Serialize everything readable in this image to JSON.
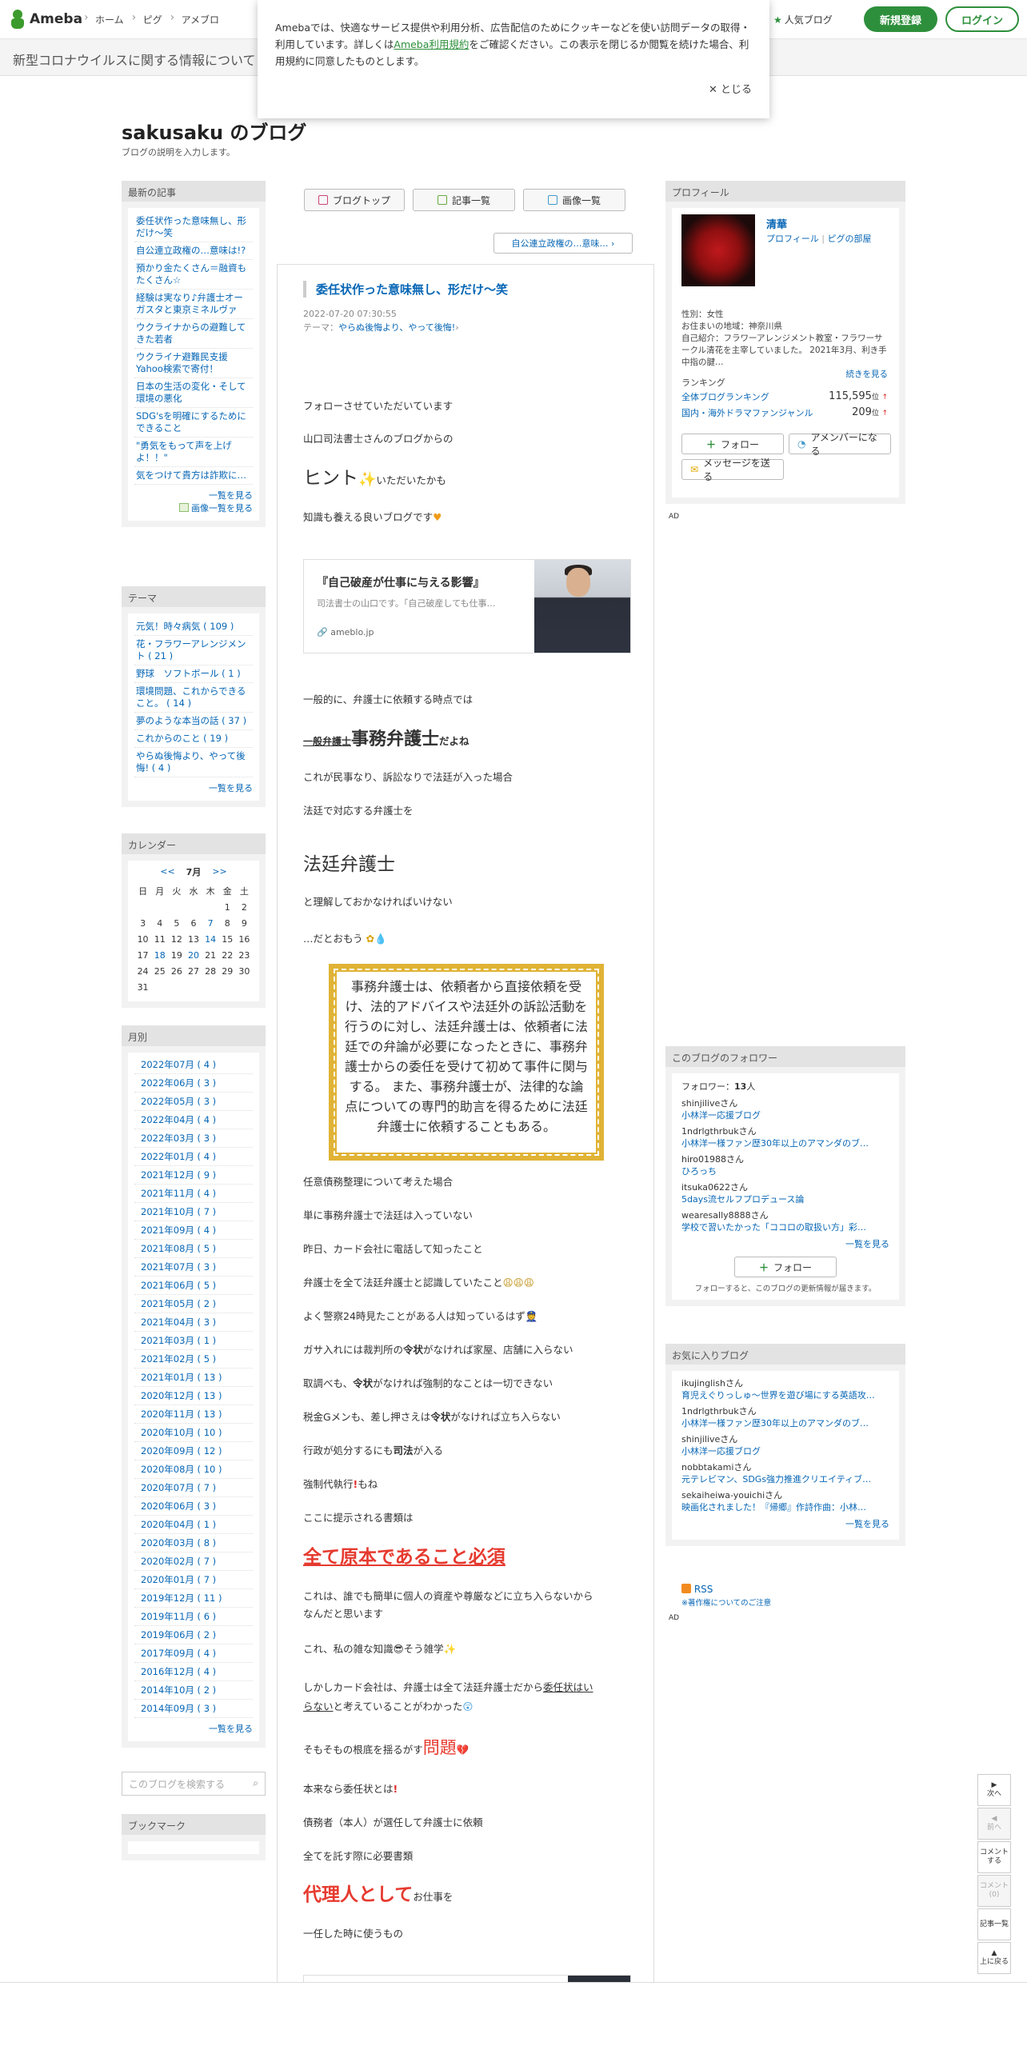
{
  "header": {
    "logo_text": "Ameba",
    "nav": [
      "ホーム",
      "ピグ",
      "アメブロ"
    ],
    "popular": "人気ブログ",
    "signup": "新規登録",
    "login": "ログイン"
  },
  "banner": {
    "text": "新型コロナウイルスに関する情報について"
  },
  "cookie": {
    "text1": "Amebaでは、快適なサービス提供や利用分析、広告配信のためにクッキーなどを使い訪問データの取得・利用しています。詳しくは",
    "link": "Ameba利用規約",
    "text2": "をご確認ください。この表示を閉じるか閲覧を続けた場合、利用規約に同意したものとします。",
    "close": "✕ とじる"
  },
  "blog": {
    "title": "sakusaku のブログ",
    "description": "ブログの説明を入力します。"
  },
  "latest": {
    "heading": "最新の記事",
    "items": [
      "委任状作った意味無し、形だけ〜笑",
      "自公連立政権の…意味は!?",
      "預かり金たくさん＝融資もたくさん☆",
      "経験は実なり♪弁護士オーガスタと東京ミネルヴァ",
      "ウクライナからの避難してきた若者",
      "ウクライナ避難民支援Yahoo検索で寄付！",
      "日本の生活の変化・そして環境の悪化",
      "SDG'sを明確にするためにできること",
      "\"勇気をもって声を上げよ！！\"",
      "気をつけて貴方は詐欺に…"
    ],
    "more": "一覧を見る",
    "images": "画像一覧を見る"
  },
  "themes": {
    "heading": "テーマ",
    "items": [
      "元気！時々病気 ( 109 )",
      "花・フラワーアレンジメント ( 21 )",
      "野球　ソフトボール ( 1 )",
      "環境問題、これからできること。 ( 14 )",
      "夢のような本当の話 ( 37 )",
      "これからのこと ( 19 )",
      "やらぬ後悔より、やって後悔! ( 4 )"
    ],
    "more": "一覧を見る"
  },
  "calendar": {
    "heading": "カレンダー",
    "prev": "<<",
    "month": "7月",
    "next": ">>",
    "weekdays": [
      "日",
      "月",
      "火",
      "水",
      "木",
      "金",
      "土"
    ],
    "weeks": [
      [
        "",
        "",
        "",
        "",
        "",
        "1",
        "2"
      ],
      [
        "3",
        "4",
        "5",
        "6",
        "7",
        "8",
        "9"
      ],
      [
        "10",
        "11",
        "12",
        "13",
        "14",
        "15",
        "16"
      ],
      [
        "17",
        "18",
        "19",
        "20",
        "21",
        "22",
        "23"
      ],
      [
        "24",
        "25",
        "26",
        "27",
        "28",
        "29",
        "30"
      ],
      [
        "31",
        "",
        "",
        "",
        "",
        "",
        ""
      ]
    ],
    "linked_days": [
      "7",
      "14",
      "18",
      "20"
    ]
  },
  "archive": {
    "heading": "月別",
    "items": [
      "2022年07月 ( 4 )",
      "2022年06月 ( 3 )",
      "2022年05月 ( 3 )",
      "2022年04月 ( 4 )",
      "2022年03月 ( 3 )",
      "2022年01月 ( 4 )",
      "2021年12月 ( 9 )",
      "2021年11月 ( 4 )",
      "2021年10月 ( 7 )",
      "2021年09月 ( 4 )",
      "2021年08月 ( 5 )",
      "2021年07月 ( 3 )",
      "2021年06月 ( 5 )",
      "2021年05月 ( 2 )",
      "2021年04月 ( 3 )",
      "2021年03月 ( 1 )",
      "2021年02月 ( 5 )",
      "2021年01月 ( 13 )",
      "2020年12月 ( 13 )",
      "2020年11月 ( 13 )",
      "2020年10月 ( 10 )",
      "2020年09月 ( 12 )",
      "2020年08月 ( 10 )",
      "2020年07月 ( 7 )",
      "2020年06月 ( 3 )",
      "2020年04月 ( 1 )",
      "2020年03月 ( 8 )",
      "2020年02月 ( 7 )",
      "2020年01月 ( 7 )",
      "2019年12月 ( 11 )",
      "2019年11月 ( 6 )",
      "2019年06月 ( 2 )",
      "2017年09月 ( 4 )",
      "2016年12月 ( 4 )",
      "2014年10月 ( 2 )",
      "2014年09月 ( 3 )"
    ],
    "more": "一覧を見る"
  },
  "search": {
    "placeholder": "このブログを検索する"
  },
  "bookmark": {
    "heading": "ブックマーク"
  },
  "tabs": [
    "ブログトップ",
    "記事一覧",
    "画像一覧"
  ],
  "prev_article": "自公連立政権の…意味…",
  "article": {
    "title": "委任状作った意味無し、形だけ〜笑",
    "date": "2022-07-20 07:30:55",
    "theme_label": "テーマ：",
    "theme": "やらぬ後悔より、やって後悔!",
    "p1": "フォローさせていただいています",
    "p2": "山口司法書士さんのブログからの",
    "hint_big": "ヒント",
    "hint_small": "いただいたかも",
    "p4": "知識も養える良いブログです",
    "card_title": "『自己破産が仕事に与える影響』",
    "card_desc": "司法書士の山口です。「自己破産しても仕事…",
    "card_url": "ameblo.jp",
    "p5": "一般的に、弁護士に依頼する時点では",
    "p6_small": "一般弁護士",
    "p6_big": "事務弁護士",
    "p6_end": "だよね",
    "p7": "これが民事なり、訴訟なりで法廷が入った場合",
    "p8": "法廷で対応する弁護士を",
    "p9": "法廷弁護士",
    "p10": "と理解しておかなければいけない",
    "p11": "…だとおもう",
    "quote": "事務弁護士は、依頼者から直接依頼を受け、法的アドバイスや法廷外の訴訟活動を行うのに対し、法廷弁護士は、依頼者に法廷での弁論が必要になったときに、事務弁護士からの委任を受けて初めて事件に関与する。 また、事務弁護士が、法律的な論点についての専門的助言を得るために法廷弁護士に依頼することもある。",
    "p12": "任意債務整理について考えた場合",
    "p13": "単に事務弁護士で法廷は入っていない",
    "p14": "昨日、カード会社に電話して知ったこと",
    "p15": "弁護士を全て法廷弁護士と認識していたこと",
    "p16": "よく警察24時見たことがある人は知っているはず",
    "p17a": "ガサ入れには裁判所の",
    "p17b": "令状",
    "p17c": "がなければ家屋、店舗に入らない",
    "p18a": "取調べも、",
    "p18b": "令状",
    "p18c": "がなければ強制的なことは一切できない",
    "p19a": "税金Gメンも、差し押さえは",
    "p19b": "令状",
    "p19c": "がなければ立ち入らない",
    "p20a": "行政が処分するにも",
    "p20b": "司法",
    "p20c": "が入る",
    "p21a": "強制代執行",
    "p21b": "もね",
    "p22": "ここに提示される書類は",
    "p23": "全て原本であること必須",
    "p24a": "これは、誰でも簡単に個人の資産や尊厳などに立ち入らないから",
    "p24b": "なんだと思います",
    "p25a": "これ、私の雑な知識",
    "p25b": "そう雑学",
    "p26a": "しかしカード会社は、弁護士は全て法廷弁護士だから",
    "p26b": "委任状はい",
    "p26c": "らない",
    "p26d": "と考えていることがわかった",
    "p27a": "そもそもの根底を揺るがす",
    "p27b": "問題",
    "p28": "本来なら委任状とは",
    "p29": "債務者（本人）が選任して弁護士に依頼",
    "p30": "全てを託す際に必要書類",
    "p31a": "代理人として",
    "p31b": "お仕事を",
    "p32": "一任した時に使うもの"
  },
  "profile": {
    "heading": "プロフィール",
    "name": "清華",
    "link1": "プロフィール",
    "link2": "ピグの部屋",
    "gender": "性別：女性",
    "area": "お住まいの地域：神奈川県",
    "intro": "自己紹介：フラワーアレンジメント教室・フラワーサークル清花を主宰していました。 2021年3月、利き手中指の腱…",
    "more": "続きを見る",
    "ranking_label": "ランキング",
    "rank1_name": "全体ブログランキング",
    "rank1_val": "115,595",
    "rank2_name": "国内・海外ドラマファンジャンル",
    "rank2_val": "209",
    "rank_unit": "位",
    "follow": "フォロー",
    "amember": "アメンバーになる",
    "message": "メッセージを送る"
  },
  "ad": "AD",
  "followers": {
    "heading": "このブログのフォロワー",
    "count_label": "フォロワー：",
    "count": "13",
    "count_unit": "人",
    "items": [
      {
        "user": "shinjiliveさん",
        "blog": "小林洋一応援ブログ"
      },
      {
        "user": "1ndrlgthrbukさん",
        "blog": "小林洋一様ファン歴30年以上のアマンダのブ…"
      },
      {
        "user": "hiro01988さん",
        "blog": "ひろっち"
      },
      {
        "user": "itsuka0622さん",
        "blog": "5days流セルフプロデュース論"
      },
      {
        "user": "wearesally8888さん",
        "blog": "学校で習いたかった「ココロの取扱い方」彩…"
      }
    ],
    "more": "一覧を見る",
    "follow": "フォロー",
    "note": "フォローすると、このブログの更新情報が届きます。"
  },
  "favorites": {
    "heading": "お気に入りブログ",
    "items": [
      {
        "user": "ikujinglishさん",
        "blog": "育児えぐりっしゅ〜世界を遊び場にする英語攻…"
      },
      {
        "user": "1ndrlgthrbukさん",
        "blog": "小林洋一様ファン歴30年以上のアマンダのブ…"
      },
      {
        "user": "shinjiliveさん",
        "blog": "小林洋一応援ブログ"
      },
      {
        "user": "nobbtakamiさん",
        "blog": "元テレビマン、SDGs強力推進クリエイティブ…"
      },
      {
        "user": "sekaiheiwa-youichiさん",
        "blog": "映画化されました！『帰郷』作詩作曲：小林…"
      }
    ],
    "more": "一覧を見る"
  },
  "rss": {
    "label": "RSS",
    "note": "※著作権についてのご注意"
  },
  "sidenav": {
    "next": "次へ",
    "prev": "前へ",
    "comment": "コメントする",
    "comment_count": "コメント(0)",
    "list": "記事一覧",
    "top": "上に戻る"
  }
}
